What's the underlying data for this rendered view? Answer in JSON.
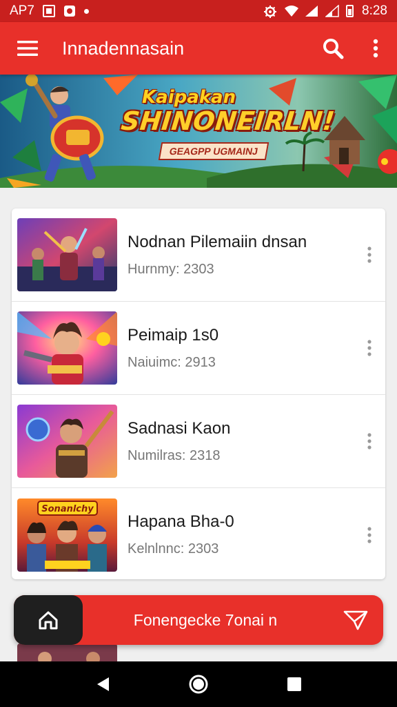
{
  "status_bar": {
    "left_text": "AP7",
    "time": "8:28",
    "icons": [
      "image-icon",
      "app-notification-icon",
      "dot-icon",
      "settings-sync-icon",
      "wifi-icon",
      "signal-icon",
      "signal-icon",
      "battery-icon"
    ]
  },
  "app_bar": {
    "title": "Innadennasain",
    "menu_icon": "hamburger-icon",
    "search_icon": "search-icon",
    "more_icon": "more-vert-icon"
  },
  "banner": {
    "line1": "Kaipakan",
    "line2": "SHINONEIRLN!",
    "badge": "GEAGPP UGMAINJ"
  },
  "list": {
    "items": [
      {
        "title": "Nodnan Pilemaiin dnsan",
        "subtitle": "Hurnmy: 2303"
      },
      {
        "title": "Peimaip 1s0",
        "subtitle": "Naiuimc: 2913"
      },
      {
        "title": "Sadnasi Kaon",
        "subtitle": "Numilras: 2318"
      },
      {
        "title": "Hapana Bha-0",
        "subtitle": "Kelnlnnc: 2303"
      }
    ],
    "thumb_banner_text": "Sonanlchy"
  },
  "bottom_bar": {
    "label": "Fonengecke 7onai n",
    "home_icon": "home-icon",
    "share_icon": "share-icon"
  },
  "nav_bar": {
    "back_icon": "back-icon",
    "home_icon": "home-circle-icon",
    "recents_icon": "recents-icon"
  },
  "colors": {
    "primary": "#e8302a",
    "status_bar": "#c8201e",
    "dark": "#1f1f1f"
  }
}
